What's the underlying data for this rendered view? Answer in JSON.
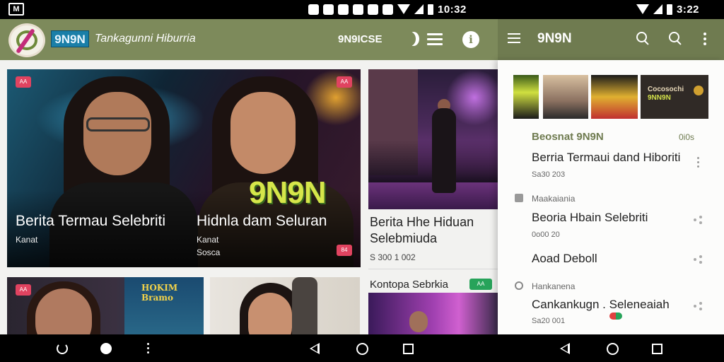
{
  "status_bar": {
    "left_icon": "M",
    "time_left": "10:32",
    "time_right": "3:22"
  },
  "app_bar": {
    "brand": "9N9N",
    "subtitle": "Tankagunni Hiburria",
    "lang": "9N9ICSE",
    "icons": [
      "moon-icon",
      "menu-icon",
      "info-icon"
    ]
  },
  "hero": {
    "badge_left": "AA",
    "badge_right": "AA",
    "logo_text": "9N9N",
    "title_left": "Berita Termau Selebriti",
    "meta_left": "Kanat",
    "title_right": "Hidnla dam Seluran",
    "meta_right_1": "Kanat",
    "meta_right_2": "Sosca",
    "badge_bottom": "84"
  },
  "side_card": {
    "title": "Berita Hhe Hiduan Selebmiuda",
    "date": "S 300 1 002",
    "category": "Kontopa Sebrkia",
    "category_badge": "AA"
  },
  "small_cards": {
    "badge": "AA",
    "poster_text": "HOKIM Bramo"
  },
  "drawer_bar": {
    "title": "9N9N",
    "icons": [
      "menu-icon",
      "search-icon",
      "search-icon",
      "kebab-icon"
    ]
  },
  "drawer": {
    "thumb4_line1": "Cocosochi",
    "thumb4_line2": "9NN9N",
    "section": "Beosnat 9N9N",
    "section_right": "0i0s",
    "items": [
      {
        "title": "Berria Termaui dand Hiboriti",
        "sub": "Sa30 203"
      },
      {
        "group": "Maakaiania"
      },
      {
        "title": "Beoria Hbain Selebriti",
        "sub": "0o00 20"
      },
      {
        "title": "Aoad Deboll",
        "sub": ""
      },
      {
        "group": "Hankanena"
      },
      {
        "title": "Cankankugn . Seleneaiah",
        "sub": "Sa20 001"
      }
    ]
  },
  "nav_bar": {
    "icons": [
      "rotate-icon",
      "home-dot-icon",
      "more-icon",
      "back-icon",
      "home-icon",
      "recents-icon",
      "back-icon",
      "home-icon",
      "recents-icon"
    ]
  }
}
